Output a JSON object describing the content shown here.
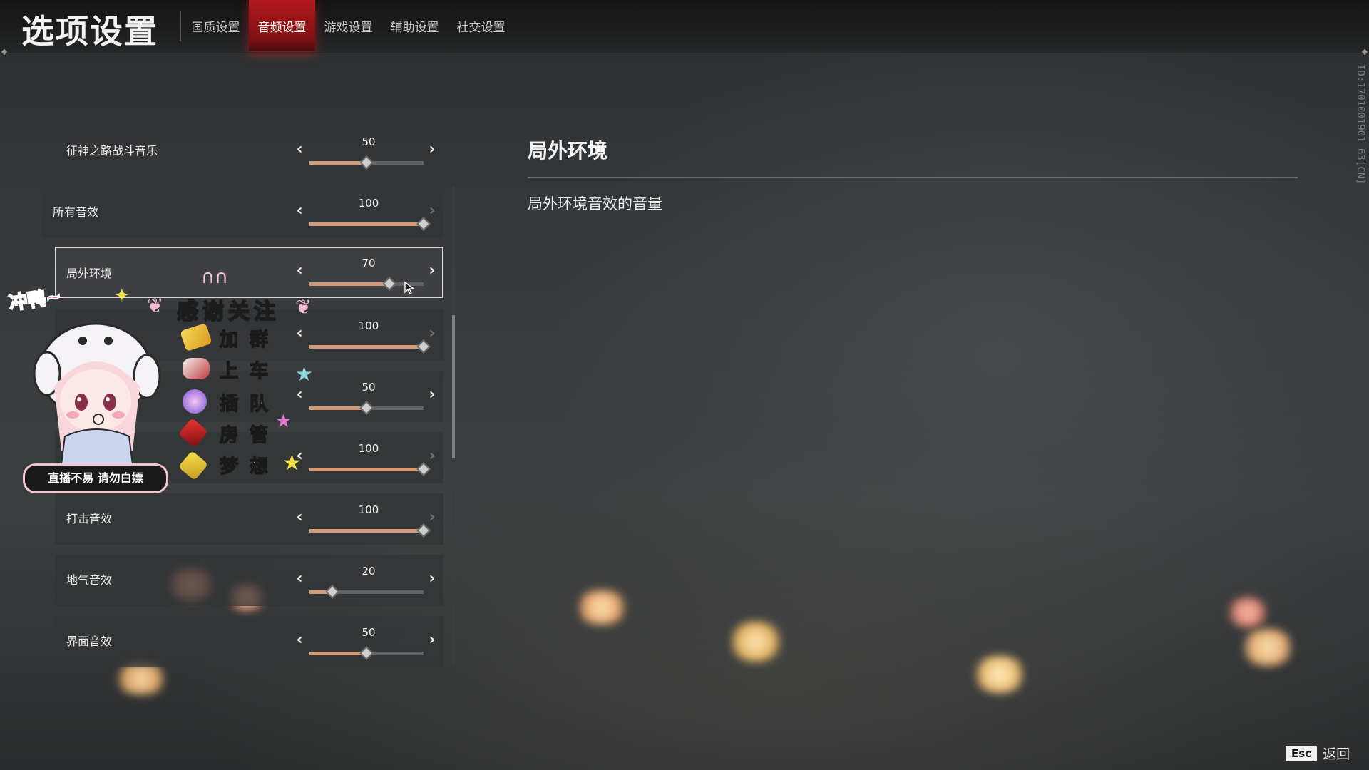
{
  "page": {
    "title": "选项设置",
    "build_id": "ID:1701001901 63[CN]"
  },
  "tabs": [
    {
      "label": "画质设置",
      "active": false
    },
    {
      "label": "音频设置",
      "active": true
    },
    {
      "label": "游戏设置",
      "active": false
    },
    {
      "label": "辅助设置",
      "active": false
    },
    {
      "label": "社交设置",
      "active": false
    }
  ],
  "settings": [
    {
      "label": "征神之路战斗音乐",
      "value": "50",
      "level": 0.5
    },
    {
      "label": "所有音效",
      "value": "100",
      "level": 1.0
    },
    {
      "label": "局外环境",
      "value": "70",
      "level": 0.7,
      "selected": true
    },
    {
      "label": "",
      "value": "100",
      "level": 1.0
    },
    {
      "label": "",
      "value": "50",
      "level": 0.5
    },
    {
      "label": "",
      "value": "100",
      "level": 1.0
    },
    {
      "label": "打击音效",
      "value": "100",
      "level": 1.0
    },
    {
      "label": "地气音效",
      "value": "20",
      "level": 0.2
    },
    {
      "label": "界面音效",
      "value": "50",
      "level": 0.5
    }
  ],
  "description": {
    "title": "局外环境",
    "text": "局外环境音效的音量"
  },
  "footer": {
    "esc_key": "Esc",
    "back_label": "返回"
  },
  "overlay": {
    "exclaim": "冲鸭~",
    "thanks": "感谢关注",
    "perks": [
      "加群",
      "上车",
      "插队",
      "房管",
      "梦想"
    ],
    "banner": "直播不易 请勿白嫖"
  },
  "colors": {
    "active_tab": "#b2191b",
    "slider_fill": "#d79a78",
    "bokeh": "#f0c58a"
  }
}
